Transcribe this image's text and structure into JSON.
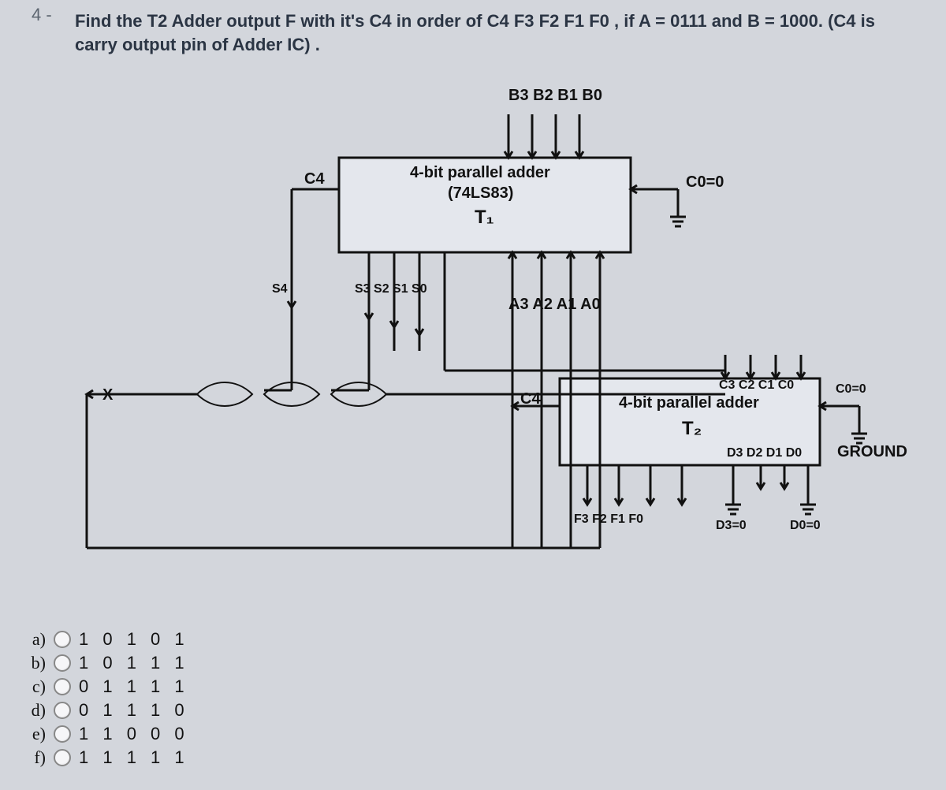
{
  "question": {
    "number": "4 -",
    "text": "Find the T2 Adder output F with it's C4 in order of C4 F3 F2 F1 F0 , if A = 0111  and B = 1000. (C4 is carry output pin  of Adder IC) ."
  },
  "diagram": {
    "top_inputs": "B3 B2 B1 B0",
    "t1": {
      "line1": "4-bit parallel adder",
      "line2": "(74LS83)",
      "line3": "T₁",
      "c4": "C4",
      "c0": "C0=0",
      "s_outputs": "S3 S2 S1 S0",
      "s4": "S4",
      "a_inputs": "A3 A2 A1 A0"
    },
    "t2": {
      "c_inputs": "C3 C2 C1 C0",
      "title": "4-bit parallel adder",
      "line2": "T₂",
      "c4": "C4",
      "c0": "C0=0",
      "d_outputs": "D3 D2 D1 D0",
      "f_outputs": "F3  F2  F1  F0",
      "d3": "D3=0",
      "d0": "D0=0",
      "ground": "GROUND"
    },
    "xlabel": "X"
  },
  "answers": [
    {
      "letter": "a)",
      "value": "1 0 1 0 1"
    },
    {
      "letter": "b)",
      "value": "1 0 1 1 1"
    },
    {
      "letter": "c)",
      "value": "0 1 1 1 1"
    },
    {
      "letter": "d)",
      "value": "0 1 1 1 0"
    },
    {
      "letter": "e)",
      "value": "1 1 0 0 0"
    },
    {
      "letter": "f)",
      "value": "1 1 1 1 1"
    }
  ]
}
